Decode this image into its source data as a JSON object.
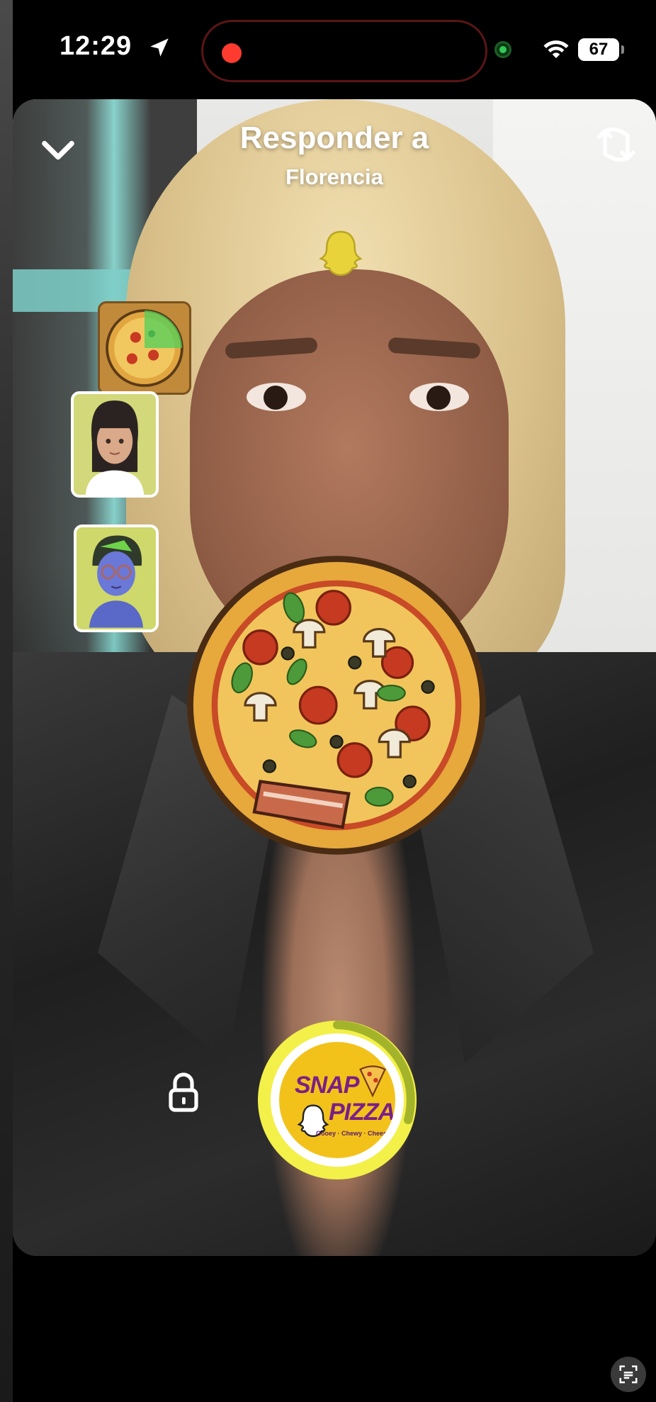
{
  "status_bar": {
    "time": "12:29",
    "battery": "67",
    "icons": [
      "location-arrow-icon",
      "recording-dot-icon",
      "camera-indicator-icon",
      "wifi-icon",
      "battery-icon"
    ]
  },
  "header": {
    "title": "Responder a",
    "subtitle": "Florencia",
    "left_icon": "chevron-down-icon",
    "right_icon": "flip-camera-icon"
  },
  "lens_carousel": [
    {
      "name": "pizza-lens",
      "selected": true
    },
    {
      "name": "bitmoji-avatar-1"
    },
    {
      "name": "bitmoji-avatar-2"
    }
  ],
  "capture": {
    "logo_line1": "SNAP",
    "logo_line2": "PIZZA",
    "logo_tagline": "Gooey · Chewy · Cheesy",
    "lock_icon": "lock-icon"
  },
  "colors": {
    "capture_ring": "#f3f04a",
    "logo_bg": "#f2c21b",
    "logo_text": "#7a1f86",
    "recording": "#ff3b30"
  }
}
